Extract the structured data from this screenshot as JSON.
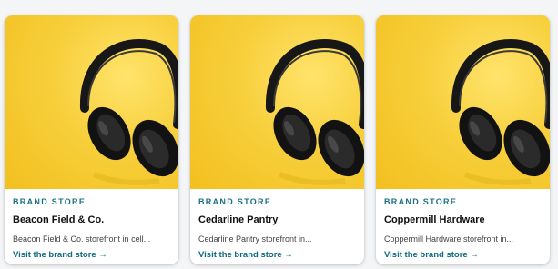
{
  "theme": {
    "accent": "#1a7084",
    "image_bg": "#f5c52a"
  },
  "cards": [
    {
      "image": "headphones-photo",
      "eyebrow": "BRAND STORE",
      "title": "Beacon Field & Co.",
      "description": "Beacon Field & Co. storefront in cell...",
      "link_label": "Visit the brand store →"
    },
    {
      "image": "headphones-photo",
      "eyebrow": "BRAND STORE",
      "title": "Cedarline Pantry",
      "description": "Cedarline Pantry storefront in...",
      "link_label": "Visit the brand store →"
    },
    {
      "image": "headphones-photo",
      "eyebrow": "BRAND STORE",
      "title": "Coppermill Hardware",
      "description": "Coppermill Hardware storefront in...",
      "link_label": "Visit the brand store →"
    }
  ]
}
